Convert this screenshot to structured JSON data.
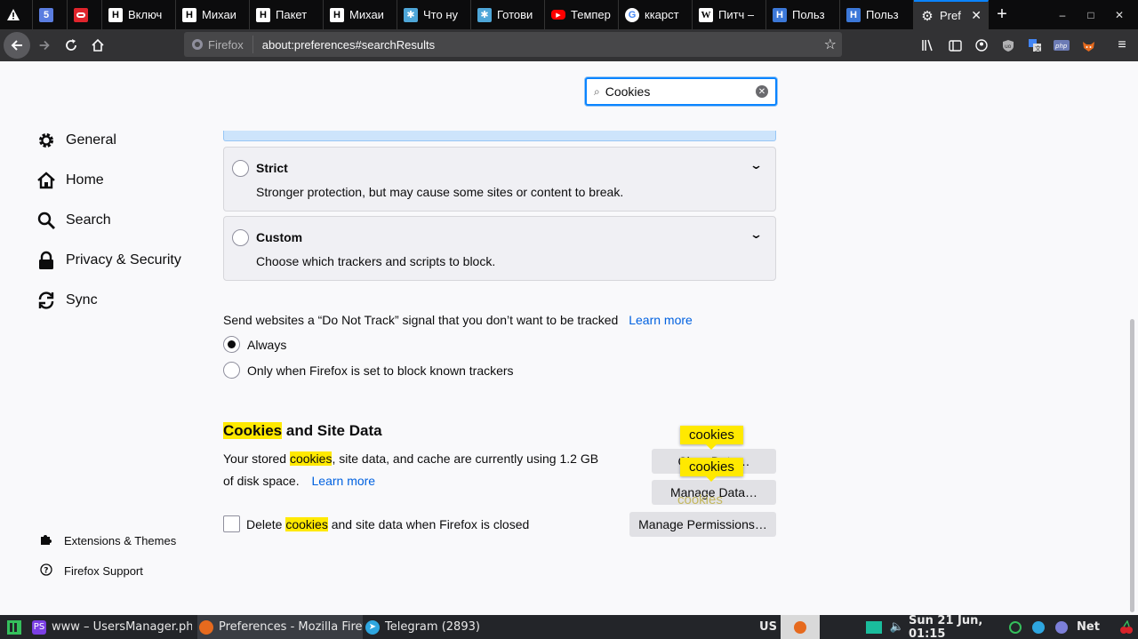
{
  "browser": {
    "tabs": [
      {
        "title": "",
        "icon": "warning-icon",
        "color": "#ffffff"
      },
      {
        "title": "",
        "icon": "html5-icon",
        "color": "#5a7de0"
      },
      {
        "title": "",
        "icon": "oracle-icon",
        "color": "#e0242c"
      },
      {
        "title": "Включ",
        "icon": "habr-icon",
        "color": "#ffffff"
      },
      {
        "title": "Михаи",
        "icon": "habr-icon",
        "color": "#ffffff"
      },
      {
        "title": "Пакет",
        "icon": "habr-icon",
        "color": "#ffffff"
      },
      {
        "title": "Михаи",
        "icon": "habr-icon",
        "color": "#ffffff"
      },
      {
        "title": "Что ну",
        "icon": "snowflake-icon",
        "color": "#4ea6d8"
      },
      {
        "title": "Готови",
        "icon": "snowflake-icon",
        "color": "#4ea6d8"
      },
      {
        "title": "Темпер",
        "icon": "youtube-icon",
        "color": "#ff0000"
      },
      {
        "title": "ккарст",
        "icon": "google-icon",
        "color": "#ffffff"
      },
      {
        "title": "Питч –",
        "icon": "wikipedia-icon",
        "color": "#ffffff"
      },
      {
        "title": "Польз",
        "icon": "h-icon",
        "color": "#3c78d8"
      },
      {
        "title": "Польз",
        "icon": "h-icon",
        "color": "#3c78d8"
      },
      {
        "title": "Pref",
        "icon": "gear-icon",
        "color": "#ffffff",
        "active": true
      }
    ],
    "identity_label": "Firefox",
    "url": "about:preferences#searchResults"
  },
  "prefs": {
    "search_value": "Cookies",
    "categories": [
      {
        "label": "General",
        "icon": "gear-icon"
      },
      {
        "label": "Home",
        "icon": "home-icon"
      },
      {
        "label": "Search",
        "icon": "search-icon"
      },
      {
        "label": "Privacy & Security",
        "icon": "lock-icon"
      },
      {
        "label": "Sync",
        "icon": "sync-icon"
      }
    ],
    "footer_links": [
      {
        "label": "Extensions & Themes",
        "icon": "puzzle-icon"
      },
      {
        "label": "Firefox Support",
        "icon": "help-icon"
      }
    ],
    "tracking": {
      "strict_title": "Strict",
      "strict_desc": "Stronger protection, but may cause some sites or content to break.",
      "custom_title": "Custom",
      "custom_desc": "Choose which trackers and scripts to block."
    },
    "dnt": {
      "label": "Send websites a “Do Not Track” signal that you don’t want to be tracked",
      "learn_more": "Learn more",
      "always": "Always",
      "only_when": "Only when Firefox is set to block known trackers"
    },
    "cookies": {
      "heading_hl": "Cookies",
      "heading_rest": " and Site Data",
      "desc_pre": "Your stored ",
      "desc_hl": "cookies",
      "desc_post": ", site data, and cache are currently using 1.2 GB",
      "desc_line2": "of disk space.",
      "learn_more": "Learn more",
      "clear_data": "Clear Data…",
      "manage_data": "Manage Data…",
      "manage_permissions": "Manage Permissions…",
      "delete_pre": "Delete ",
      "delete_hl": "cookies",
      "delete_post": " and site data when Firefox is closed",
      "tooltip": "cookies"
    }
  },
  "taskbar": {
    "tasks": [
      {
        "label": "www – UsersManager.ph...",
        "icon": "phpstorm-icon"
      },
      {
        "label": "Preferences - Mozilla Firef...",
        "icon": "firefox-icon"
      },
      {
        "label": "Telegram (2893)",
        "icon": "telegram-icon"
      }
    ],
    "keyboard": "US",
    "clock": "Sun 21 Jun, 01:15",
    "net": "Net"
  }
}
